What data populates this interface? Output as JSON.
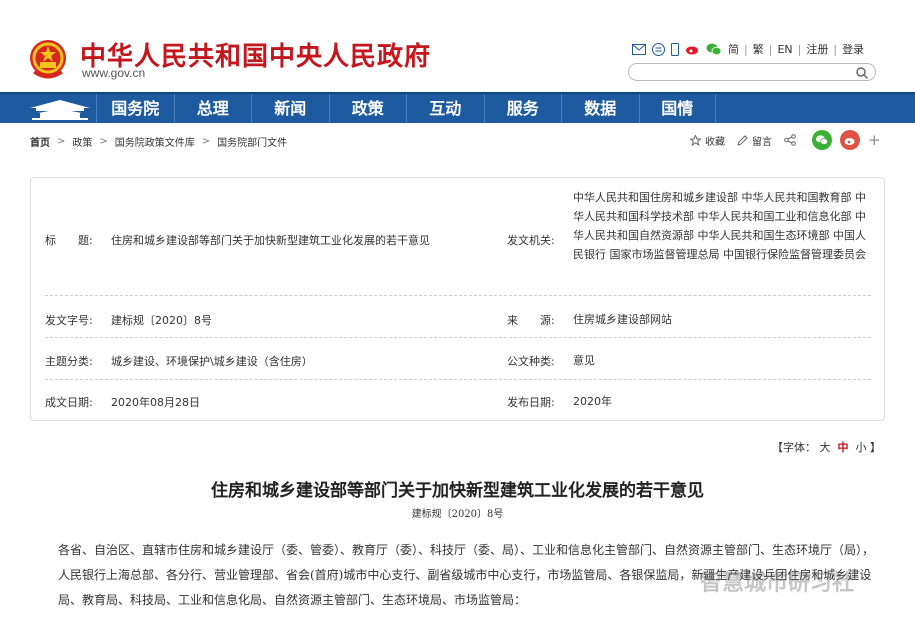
{
  "header": {
    "site_title": "中华人民共和国中央人民政府",
    "site_url": "www.gov.cn",
    "links": {
      "simplified": "简",
      "traditional": "繁",
      "english": "EN",
      "register": "注册",
      "login": "登录"
    },
    "search_placeholder": ""
  },
  "nav": {
    "items": [
      "国务院",
      "总理",
      "新闻",
      "政策",
      "互动",
      "服务",
      "数据",
      "国情"
    ]
  },
  "breadcrumb": [
    "首页",
    "政策",
    "国务院政策文件库",
    "国务院部门文件"
  ],
  "tools": {
    "favorite": "收藏",
    "comment": "留言"
  },
  "info": {
    "title_label": "标　　题:",
    "title_value": "住房和城乡建设部等部门关于加快新型建筑工业化发展的若干意见",
    "issuer_label": "发文机关:",
    "issuer_value": "中华人民共和国住房和城乡建设部 中华人民共和国教育部 中华人民共和国科学技术部 中华人民共和国工业和信息化部 中华人民共和国自然资源部 中华人民共和国生态环境部 中国人民银行 国家市场监督管理总局 中国银行保险监督管理委员会",
    "docno_label": "发文字号:",
    "docno_value": "建标规〔2020〕8号",
    "source_label": "来　　源:",
    "source_value": "住房城乡建设部网站",
    "category_label": "主题分类:",
    "category_value": "城乡建设、环境保护\\城乡建设（含住房）",
    "type_label": "公文种类:",
    "type_value": "意见",
    "date_label": "成文日期:",
    "date_value": "2020年08月28日",
    "pub_label": "发布日期:",
    "pub_value": "2020年"
  },
  "fontsize": {
    "prefix": "【字体：",
    "large": "大",
    "medium": "中",
    "small": "小",
    "suffix": "】"
  },
  "article": {
    "title": "住房和城乡建设部等部门关于加快新型建筑工业化发展的若干意见",
    "doc_no": "建标规〔2020〕8号",
    "body": "各省、自治区、直辖市住房和城乡建设厅（委、管委）、教育厅（委）、科技厅（委、局）、工业和信息化主管部门、自然资源主管部门、生态环境厅（局），人民银行上海总部、各分行、营业管理部、省会(首府)城市中心支行、副省级城市中心支行，市场监管局、各银保监局，新疆生产建设兵团住房和城乡建设局、教育局、科技局、工业和信息化局、自然资源主管部门、生态环境局、市场监管局："
  },
  "watermark": "智慧城市研习社",
  "colors": {
    "brand_red": "#c4161c",
    "nav_blue": "#1e5aa0"
  }
}
